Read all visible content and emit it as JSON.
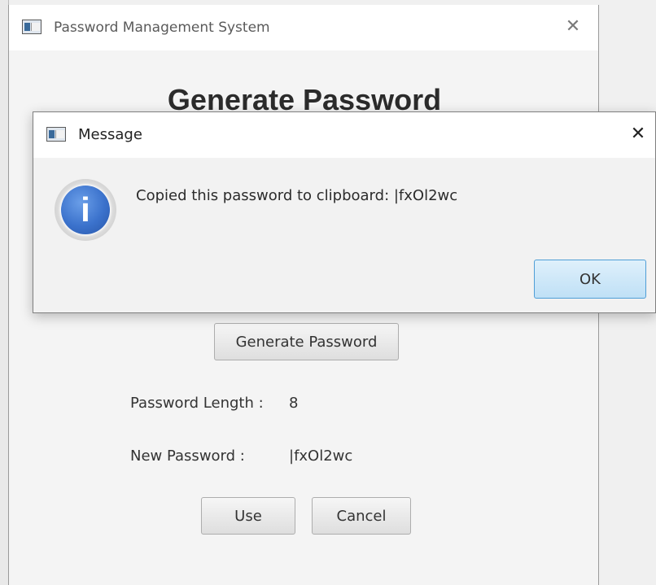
{
  "main_window": {
    "title": "Password Management System",
    "heading": "Generate Password",
    "generate_button": "Generate Password",
    "length_label": "Password Length :",
    "length_value": "8",
    "new_password_label": "New Password :",
    "new_password_value": "|fxOl2wc",
    "use_button": "Use",
    "cancel_button": "Cancel",
    "close_glyph": "✕"
  },
  "message_dialog": {
    "title": "Message",
    "text": "Copied this password to clipboard: |fxOl2wc",
    "ok_button": "OK",
    "close_glyph": "✕",
    "icon": "info-icon",
    "icon_glyph": "i"
  },
  "colors": {
    "ok_border": "#4f9ed6",
    "info_blue": "#3b72cc"
  }
}
